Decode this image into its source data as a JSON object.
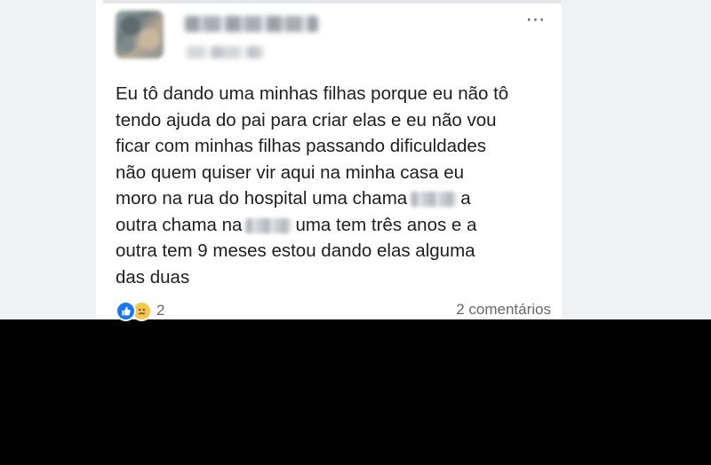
{
  "post": {
    "text_lines": [
      "Eu tô dando uma minhas filhas porque eu não tô",
      "tendo ajuda do pai para criar elas e eu não vou",
      "ficar com minhas filhas passando dificuldades",
      "não quem quiser vir aqui na minha casa eu",
      "moro na rua do hospital uma chama",
      "a",
      "outra chama na",
      "uma tem três anos e a",
      "outra tem 9 meses estou dando elas alguma",
      "das duas"
    ],
    "menu_icon": "more-horizontal-icon"
  },
  "footer": {
    "reaction_icons": [
      "like-icon",
      "sad-icon"
    ],
    "reaction_count": "2",
    "comments_label": "2 comentários"
  },
  "colors": {
    "like_blue": "#1877f2",
    "sad_yellow": "#f7c64a",
    "text": "#1c1e21",
    "muted": "#65676b"
  }
}
